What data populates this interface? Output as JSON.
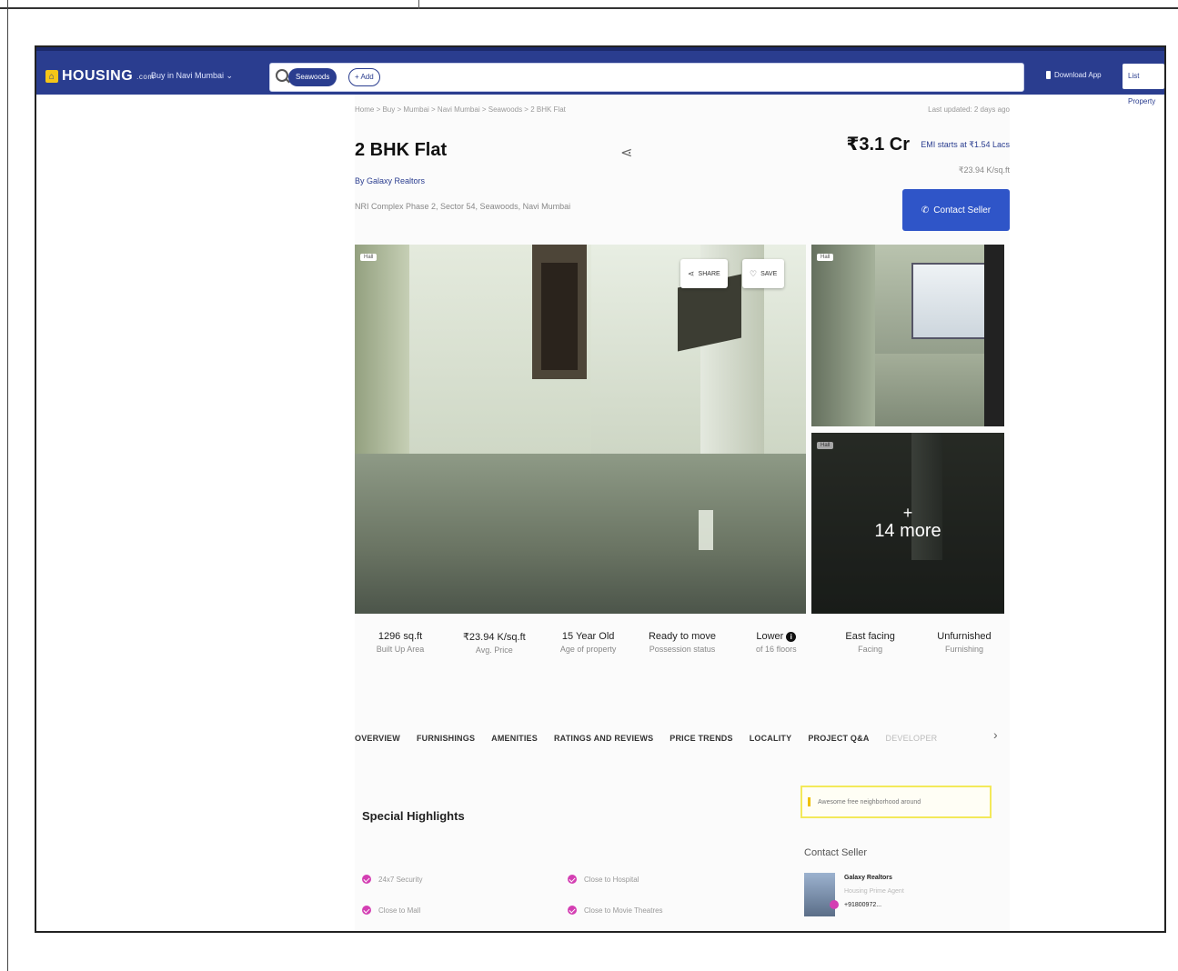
{
  "header": {
    "logo_text": "HOUSING",
    "logo_suffix": ".com",
    "city_select": "Buy in Navi Mumbai",
    "search_chip": "Seawoods",
    "search_add": "+ Add",
    "download_app": "Download App",
    "list_property": "List Property"
  },
  "listing": {
    "breadcrumb": "Home > Buy > Mumbai > Navi Mumbai > Seawoods > 2 BHK Flat",
    "last_updated": "Last updated: 2 days ago",
    "title": "2 BHK Flat",
    "price": "₹3.1 Cr",
    "emi": "EMI starts at ₹1.54 Lacs",
    "price_per_sqft": "₹23.94 K/sq.ft",
    "posted_by": "By Galaxy Realtors",
    "address": "NRI Complex Phase 2, Sector 54, Seawoods, Navi Mumbai",
    "contact_button": "Contact Seller"
  },
  "gallery": {
    "photo_tag": "Hall",
    "share_label": "SHARE",
    "save_label": "SAVE",
    "more_plus": "+",
    "more_label": "14 more"
  },
  "stats": [
    {
      "value": "1296 sq.ft",
      "label": "Built Up Area"
    },
    {
      "value": "₹23.94 K/sq.ft",
      "label": "Avg. Price"
    },
    {
      "value": "15 Year Old",
      "label": "Age of property"
    },
    {
      "value": "Ready to move",
      "label": "Possession status"
    },
    {
      "value": "Lower",
      "label": "of 16 floors"
    },
    {
      "value": "East facing",
      "label": "Facing"
    },
    {
      "value": "Unfurnished",
      "label": "Furnishing"
    }
  ],
  "tabs": [
    "OVERVIEW",
    "FURNISHINGS",
    "AMENITIES",
    "RATINGS AND REVIEWS",
    "PRICE TRENDS",
    "LOCALITY",
    "PROJECT Q&A",
    "DEVELOPER"
  ],
  "highlights": {
    "title": "Special Highlights",
    "items": [
      "24x7 Security",
      "Close to Hospital",
      "Close to Mall",
      "Close to Movie Theatres"
    ]
  },
  "neighborhood_note": "Awesome free neighborhood around",
  "seller": {
    "section_title": "Contact Seller",
    "name": "Galaxy Realtors",
    "type": "Housing Prime Agent",
    "phone": "+91800972..."
  },
  "colors": {
    "navbar": "#2a3d8f",
    "contact_button": "#2f55c8",
    "highlight_dot": "#d43fb3"
  }
}
